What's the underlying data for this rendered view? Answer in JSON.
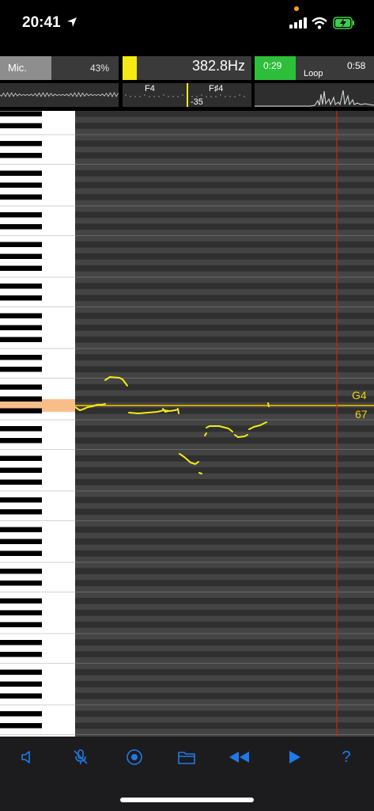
{
  "status_bar": {
    "time": "20:41"
  },
  "mic": {
    "label": "Mic.",
    "percent": "43%",
    "level": 0.43
  },
  "frequency": {
    "value": "382.8Hz"
  },
  "tuner": {
    "left_note": "F4",
    "right_note": "F♯4",
    "cents": "-35"
  },
  "loop": {
    "start": "0:29",
    "label": "Loop",
    "end": "0:58"
  },
  "current_note": {
    "name": "G4",
    "midi": "67"
  },
  "colors": {
    "accent": "#f5ea14",
    "loop_green": "#2dbf3a",
    "playhead": "#d0201c",
    "key_highlight": "#f8be8a",
    "toolbar_icon": "#1f7ae8"
  },
  "toolbar": {
    "icons": [
      "speaker-icon",
      "mic-off-icon",
      "record-icon",
      "folder-icon",
      "rewind-icon",
      "play-icon",
      "help-icon"
    ],
    "help_label": "?"
  }
}
